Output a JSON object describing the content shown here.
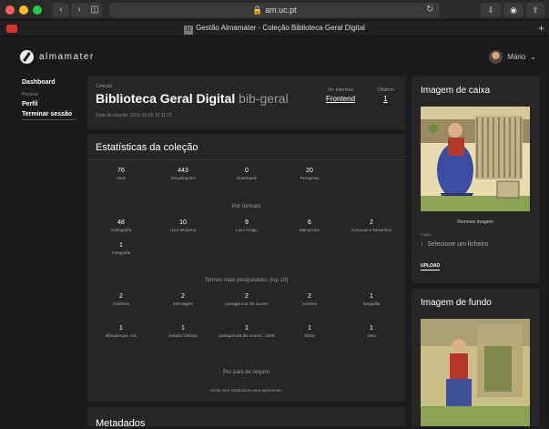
{
  "browser": {
    "address": "am.uc.pt",
    "tab_title": "Gestão Almamater - Coleção Biblioteca Geral Digital",
    "tab_favicon": "U"
  },
  "app": {
    "logo_text": "almamater",
    "user_name": "Mário"
  },
  "sidebar": {
    "dashboard": "Dashboard",
    "personal_label": "Pessoal",
    "profile": "Perfil",
    "logout": "Terminar sessão"
  },
  "collection": {
    "eyebrow": "Coleção",
    "title": "Biblioteca Geral Digital",
    "slug": "bib-geral",
    "date": "Data de criação: 2019-02-06 10:11:21",
    "interface_label": "Ver Interface",
    "interface_value": "Frontend",
    "children_label": "Children",
    "children_value": "1"
  },
  "stats": {
    "title": "Estatísticas da coleção",
    "top": [
      {
        "n": "76",
        "l": "Itens"
      },
      {
        "n": "443",
        "l": "Visualizações"
      },
      {
        "n": "0",
        "l": "Downloads"
      },
      {
        "n": "20",
        "l": "Pesquisas"
      }
    ],
    "by_format_title": "Por formato",
    "formats": [
      {
        "n": "48",
        "l": "Cartografia"
      },
      {
        "n": "10",
        "l": "Livro Moderno"
      },
      {
        "n": "9",
        "l": "Livro Antigo"
      },
      {
        "n": "6",
        "l": "Manuscrito"
      },
      {
        "n": "2",
        "l": "Gravuras e Desenhos"
      },
      {
        "n": "1",
        "l": "Fotografia"
      }
    ],
    "terms_title": "Termos mais pesquisados (top 10)",
    "terms": [
      {
        "n": "2",
        "l": "coimbras"
      },
      {
        "n": "2",
        "l": "mensagem"
      },
      {
        "n": "2",
        "l": "portugal und die azoren"
      },
      {
        "n": "2",
        "l": "coimbra"
      },
      {
        "n": "1",
        "l": "fotografia"
      },
      {
        "n": "1",
        "l": "albuquerque, luis"
      },
      {
        "n": "1",
        "l": "metodo holliana"
      },
      {
        "n": "1",
        "l": "portugal und die azoren : 1849"
      },
      {
        "n": "1",
        "l": "bíblia"
      },
      {
        "n": "1",
        "l": "saco"
      }
    ],
    "country_title": "Por país de origem",
    "country_empty": "Ainda sem estatísticas para apresentar."
  },
  "metadata": {
    "title": "Metadados"
  },
  "box_image": {
    "title": "Imagem de caixa",
    "remove": "Remover imagem",
    "capa_label": "Capa",
    "select_file": "Selecione um ficheiro",
    "upload": "UPLOAD"
  },
  "bg_image": {
    "title": "Imagem de fundo"
  },
  "colors": {
    "background": "#1b1b1b",
    "card": "#262626",
    "accent": "#ffffff"
  }
}
